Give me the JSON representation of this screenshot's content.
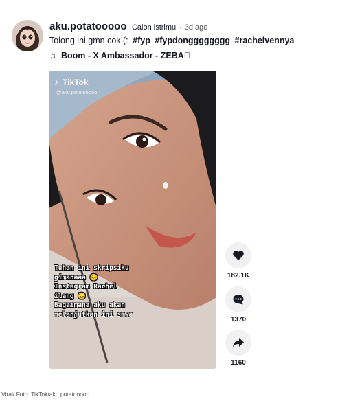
{
  "post": {
    "username": "aku.potatooooo",
    "nickname": "Calon istrimu",
    "separator": "·",
    "posted": "3d ago",
    "caption_text": "Tolong ini gmn cok (:",
    "hashtags": [
      "#fyp",
      "#fypdongggggggg",
      "#rachelvennya"
    ],
    "music_icon": "♫",
    "music": "Boom - X Ambassador - ZEBA\u0000"
  },
  "video": {
    "logo_icon": "tiktok-note-icon",
    "logo_glyph": "♪",
    "logo_text": "TikTok",
    "handle": "@aku.potatooooo",
    "overlay_lines": [
      "Tuhan ini skripsiku",
      "gimanaaa 😣",
      "Instagram Rachel",
      "ilang 😓",
      "Bagaimana aku akan",
      "melanjutkan ini smwa"
    ]
  },
  "actions": {
    "like_icon": "heart-icon",
    "like_count": "182.1K",
    "comment_icon": "comment-icon",
    "comment_count": "1370",
    "share_icon": "share-icon",
    "share_count": "1160"
  },
  "credit": "Viral/ Foto: TikTok/aku.potatooooo"
}
